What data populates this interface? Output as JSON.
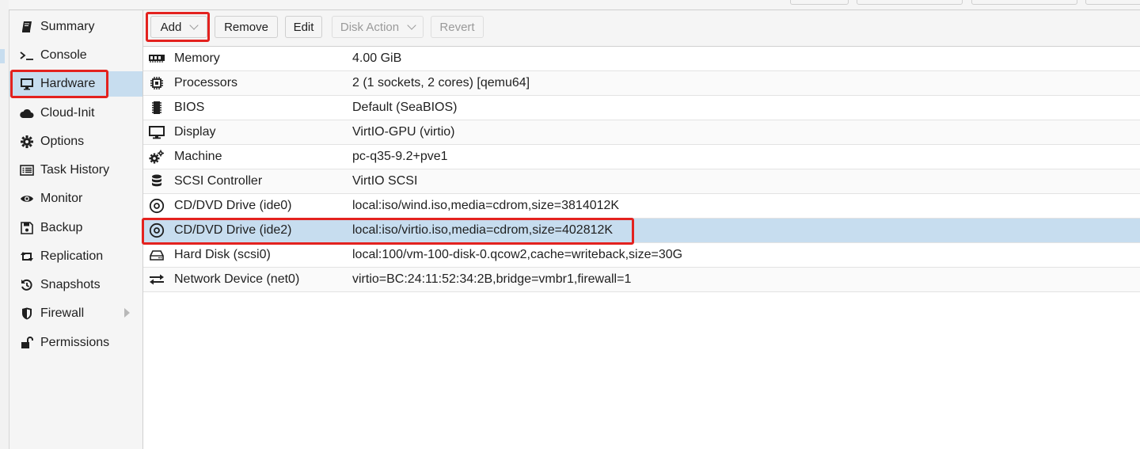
{
  "sidebar": {
    "items": [
      {
        "label": "Summary",
        "icon": "book-icon"
      },
      {
        "label": "Console",
        "icon": "terminal-icon"
      },
      {
        "label": "Hardware",
        "icon": "desktop-icon",
        "selected": true
      },
      {
        "label": "Cloud-Init",
        "icon": "cloud-icon"
      },
      {
        "label": "Options",
        "icon": "gear-icon"
      },
      {
        "label": "Task History",
        "icon": "list-alt-icon"
      },
      {
        "label": "Monitor",
        "icon": "eye-icon"
      },
      {
        "label": "Backup",
        "icon": "floppy-icon"
      },
      {
        "label": "Replication",
        "icon": "retweet-icon"
      },
      {
        "label": "Snapshots",
        "icon": "history-icon"
      },
      {
        "label": "Firewall",
        "icon": "shield-icon",
        "has_submenu": true
      },
      {
        "label": "Permissions",
        "icon": "unlock-icon"
      }
    ]
  },
  "toolbar": {
    "add_label": "Add",
    "remove_label": "Remove",
    "edit_label": "Edit",
    "disk_action_label": "Disk Action",
    "revert_label": "Revert"
  },
  "hardware": {
    "rows": [
      {
        "name": "Memory",
        "value": "4.00 GiB",
        "icon": "memory-icon"
      },
      {
        "name": "Processors",
        "value": "2 (1 sockets, 2 cores) [qemu64]",
        "icon": "cpu-icon"
      },
      {
        "name": "BIOS",
        "value": "Default (SeaBIOS)",
        "icon": "microchip-icon"
      },
      {
        "name": "Display",
        "value": "VirtIO-GPU (virtio)",
        "icon": "desktop-icon"
      },
      {
        "name": "Machine",
        "value": "pc-q35-9.2+pve1",
        "icon": "cogs-icon"
      },
      {
        "name": "SCSI Controller",
        "value": "VirtIO SCSI",
        "icon": "database-icon"
      },
      {
        "name": "CD/DVD Drive (ide0)",
        "value": "local:iso/wind.iso,media=cdrom,size=3814012K",
        "icon": "cdrom-icon"
      },
      {
        "name": "CD/DVD Drive (ide2)",
        "value": "local:iso/virtio.iso,media=cdrom,size=402812K",
        "icon": "cdrom-icon",
        "selected": true
      },
      {
        "name": "Hard Disk (scsi0)",
        "value": "local:100/vm-100-disk-0.qcow2,cache=writeback,size=30G",
        "icon": "hdd-icon"
      },
      {
        "name": "Network Device (net0)",
        "value": "virtio=BC:24:11:52:34:2B,bridge=vmbr1,firewall=1",
        "icon": "exchange-icon"
      }
    ]
  },
  "colors": {
    "selection": "#c7ddef",
    "highlight": "#e3221f",
    "toolbar_bg": "#f5f5f5"
  }
}
